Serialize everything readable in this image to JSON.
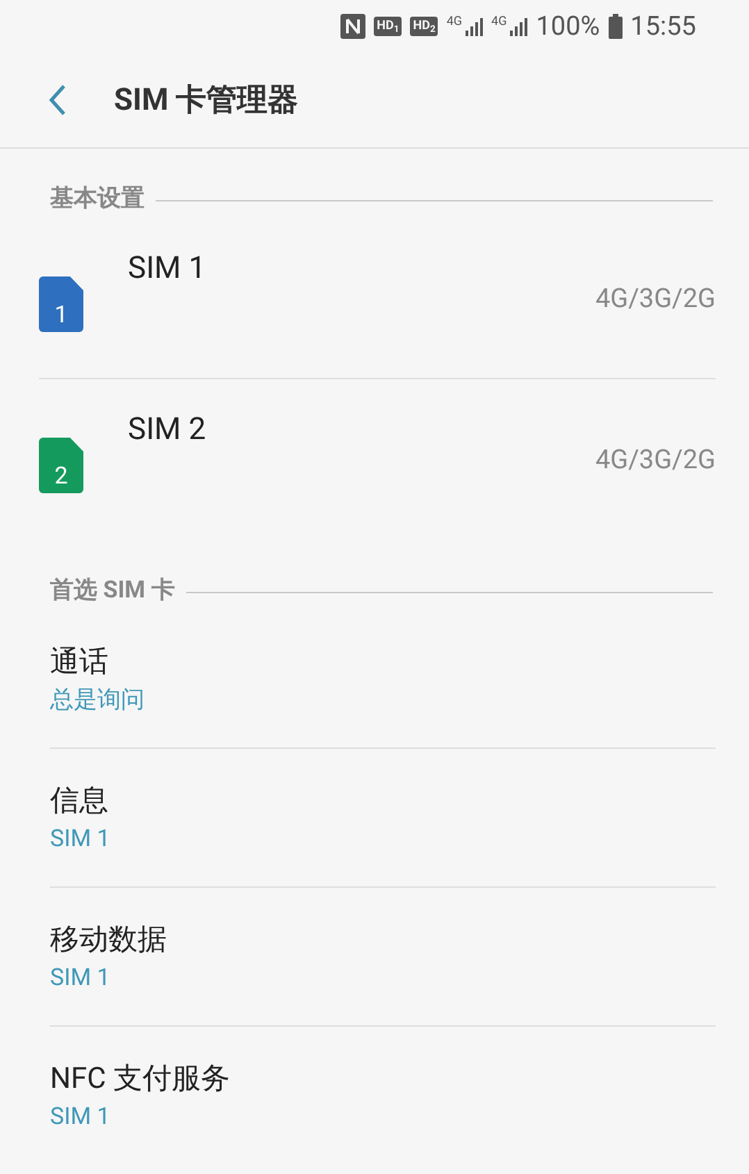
{
  "status_bar": {
    "hd_badges": [
      "HD$_{1}$",
      "HD$_{2}$"
    ],
    "network_labels": [
      "4G",
      "4G"
    ],
    "battery": "100%",
    "time": "15:55"
  },
  "header": {
    "title": "SIM 卡管理器"
  },
  "sections": [
    {
      "title": "基本设置",
      "items": [
        {
          "kind": "sim",
          "name": "SIM 1",
          "number": "1",
          "color": "#2f6fbf",
          "network": "4G/3G/2G"
        },
        {
          "kind": "sim",
          "name": "SIM 2",
          "number": "2",
          "color": "#159a5e",
          "network": "4G/3G/2G"
        }
      ]
    },
    {
      "title": "首选 SIM 卡",
      "items": [
        {
          "kind": "pref",
          "label": "通话",
          "value": "总是询问"
        },
        {
          "kind": "pref",
          "label": "信息",
          "value": "SIM 1"
        },
        {
          "kind": "pref",
          "label": "移动数据",
          "value": "SIM 1"
        },
        {
          "kind": "pref",
          "label": "NFC 支付服务",
          "value": "SIM 1"
        }
      ]
    }
  ]
}
